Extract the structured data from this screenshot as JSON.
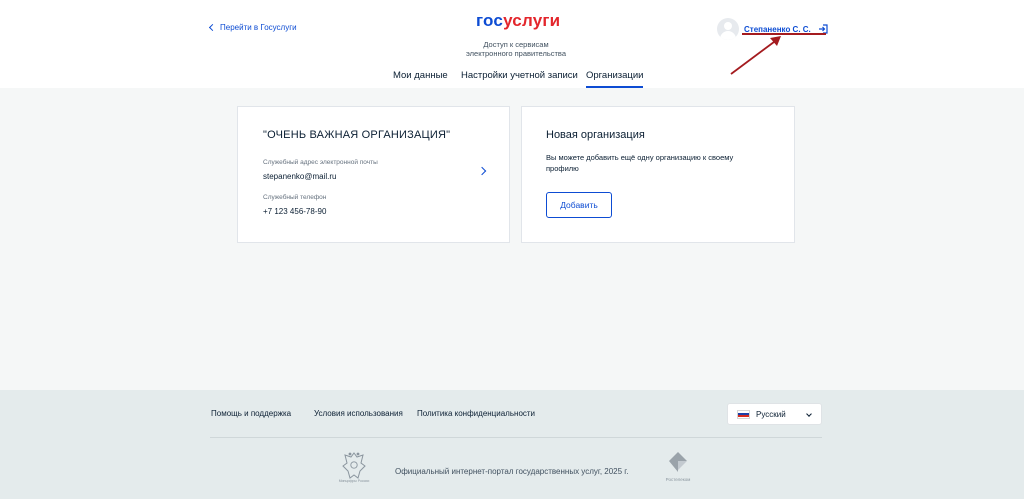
{
  "header": {
    "back_link": "Перейти в Госуслуги",
    "logo_part1": "гос",
    "logo_part2": "услуги",
    "subtitle_line1": "Доступ к сервисам",
    "subtitle_line2": "электронного правительства",
    "user_name": "Степаненко С. С.",
    "tabs": [
      {
        "label": "Мои данные",
        "active": false
      },
      {
        "label": "Настройки учетной записи",
        "active": false
      },
      {
        "label": "Организации",
        "active": true
      }
    ]
  },
  "org_card": {
    "title": "\"ОЧЕНЬ ВАЖНАЯ ОРГАНИЗАЦИЯ\"",
    "email_label": "Служебный адрес электронной почты",
    "email_value": "stepanenko@mail.ru",
    "phone_label": "Служебный телефон",
    "phone_value": "+7 123 456-78-90"
  },
  "new_org_card": {
    "title": "Новая организация",
    "description": "Вы можете добавить ещё одну организацию к своему профилю",
    "button_label": "Добавить"
  },
  "footer": {
    "links": [
      "Помощь и поддержка",
      "Условия использования",
      "Политика конфиденциальности"
    ],
    "language": "Русский",
    "emblem_caption": "Минцифры России",
    "copyright": "Официальный интернет-портал государственных услуг, 2025 г.",
    "rt_caption": "Ростелеком"
  },
  "colors": {
    "accent": "#0d4cd3",
    "logo_red": "#e3262c",
    "annotation": "#a41b1f",
    "page_bg": "#f5f7f7",
    "footer_bg": "#e4ebec"
  },
  "icons": [
    "chevron-left-icon",
    "avatar-icon",
    "logout-icon",
    "chevron-right-icon",
    "flag-icon",
    "chevron-down-icon",
    "emblem-icon",
    "rostelecom-icon"
  ]
}
